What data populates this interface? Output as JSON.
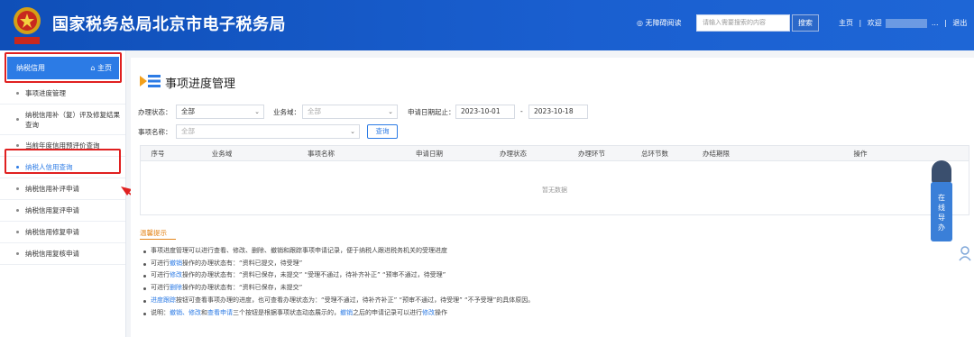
{
  "header": {
    "site_title": "国家税务总局北京市电子税务局",
    "emblem_text": "中国税务",
    "accessibility": "无障碍阅读",
    "search_placeholder": "请输入需要搜索的内容",
    "search_button": "搜索",
    "nav_home": "主页",
    "nav_welcome": "欢迎",
    "nav_ellipsis": "...",
    "nav_logout": "退出",
    "separator": "|"
  },
  "sidebar": {
    "home_tab_label": "纳税信用",
    "home_link": "主页",
    "items": [
      {
        "label": "事项进度管理"
      },
      {
        "label": "纳税信用补（复）评及修复结果查询"
      },
      {
        "label": "当前年度信用预评价查询"
      },
      {
        "label": "纳税人信用查询"
      },
      {
        "label": "纳税信用补评申请"
      },
      {
        "label": "纳税信用复评申请"
      },
      {
        "label": "纳税信用修复申请"
      },
      {
        "label": "纳税信用复核申请"
      }
    ]
  },
  "main": {
    "page_title": "事项进度管理",
    "form": {
      "status_label": "办理状态：",
      "status_value": "全部",
      "domain_label": "业务域：",
      "domain_value": "全部",
      "date_label": "申请日期起止：",
      "date_start": "2023-10-01",
      "date_sep": "-",
      "date_end": "2023-10-18",
      "item_label": "事项名称：",
      "item_value": "全部",
      "query_button": "查询"
    },
    "table": {
      "headers": [
        "序号",
        "业务域",
        "事项名称",
        "申请日期",
        "办理状态",
        "办理环节",
        "总环节数",
        "办结期限",
        "操作"
      ],
      "empty_text": "暂无数据"
    },
    "tips": {
      "title": "温馨提示",
      "lines": [
        {
          "parts": [
            "事项进度管理可以进行查看、修改、删除、撤销和跟踪事项申请记录，便于纳税人跟进税务机关的受理进度"
          ]
        },
        {
          "pre": "可进行",
          "hl": "撤销",
          "post": "操作的办理状态有：“资料已提交，待受理”"
        },
        {
          "pre": "可进行",
          "hl": "修改",
          "post": "操作的办理状态有：“资料已保存，未提交”  “受理不通过，待补齐补正”  “预审不通过，待受理”"
        },
        {
          "pre": "可进行",
          "hl": "删除",
          "post": "操作的办理状态有：“资料已保存，未提交”"
        },
        {
          "pre": "",
          "hl": "进度跟踪",
          "post": "按钮可查看事项办理的进度，也可查看办理状态为：“受理不通过，待补齐补正”  “预审不通过，待受理”  “不予受理”的具体原因。"
        },
        {
          "pre": "说明：",
          "hl": "撤销、修改",
          "mid": "和",
          "hl2": "查看申请",
          "mid2": "三个按钮是根据事项状态动态展示的，",
          "hl3": "撤销",
          "mid3": "之后的申请记录可以进行",
          "hl4": "修改",
          "post": "操作"
        }
      ]
    }
  },
  "guide_widget": {
    "label": "在线导办"
  },
  "colors": {
    "header_blue": "#1a5fd0",
    "accent_blue": "#2c7be5",
    "highlight_red": "#e02020",
    "tips_orange": "#e4871c"
  }
}
